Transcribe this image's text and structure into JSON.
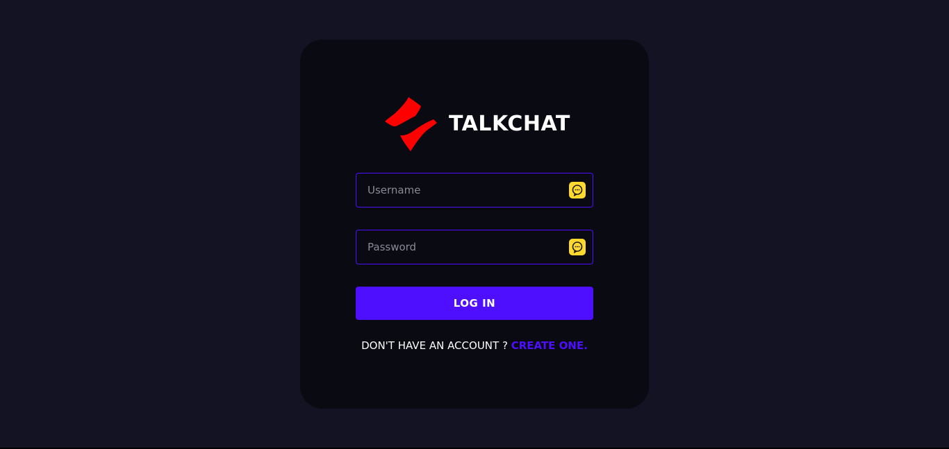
{
  "brand": {
    "name": "TALKCHAT",
    "logo_icon": "talkchat-logo-icon",
    "logo_color": "#ff0000"
  },
  "form": {
    "username": {
      "placeholder": "Username",
      "value": "",
      "icon": "chat-bubble-icon"
    },
    "password": {
      "placeholder": "Password",
      "value": "",
      "icon": "chat-bubble-icon"
    },
    "submit_label": "LOG IN",
    "signup_prompt": "DON'T HAVE AN ACCOUNT ?",
    "signup_link": "CREATE ONE."
  },
  "colors": {
    "page_background": "#131324",
    "card_background": "#0a0a12",
    "accent": "#4e0eff",
    "icon_badge": "#ffd92e"
  }
}
